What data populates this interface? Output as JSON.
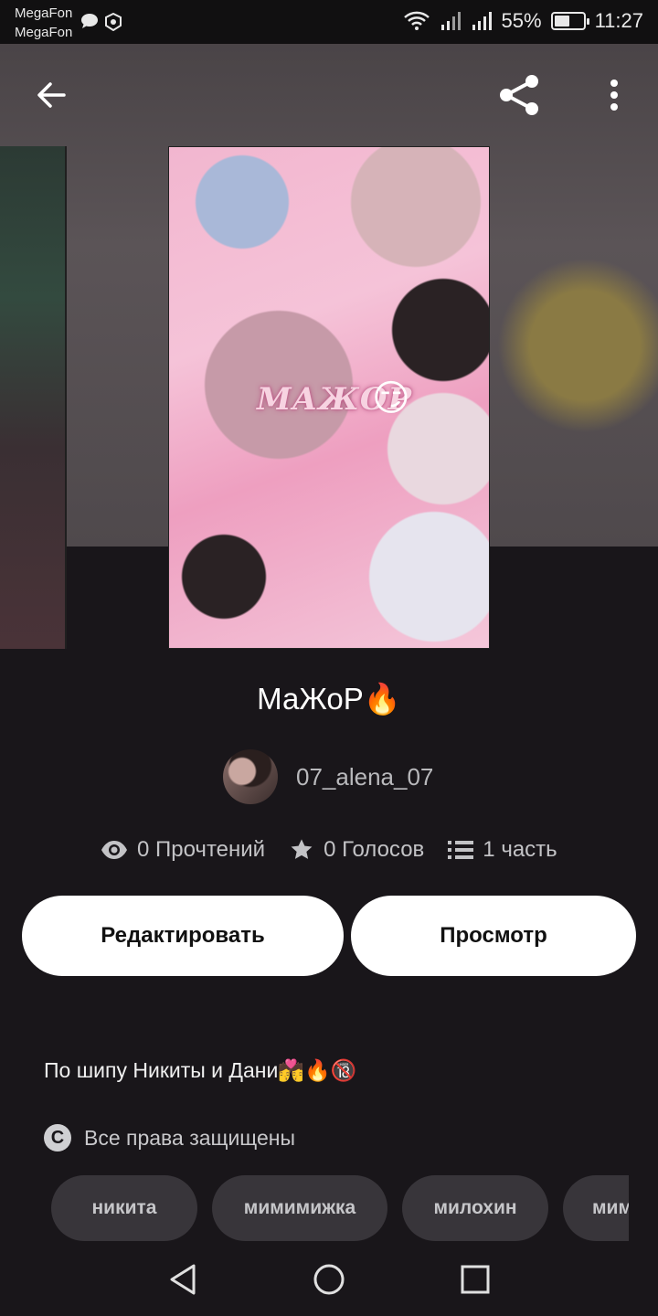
{
  "status_bar": {
    "carrier_line1": "MegaFon",
    "carrier_line2": "MegaFon",
    "battery_percent": "55%",
    "battery_level": 0.55,
    "time": "11:27"
  },
  "story": {
    "title": "МаЖоР🔥",
    "cover_text": "МАЖОР",
    "cover_emoji": "😏",
    "author": "07_alena_07",
    "stats": {
      "reads": "0 Прочтений",
      "votes": "0 Голосов",
      "parts": "1 часть"
    },
    "description": "По шипу Никиты и Дани💏🔥🔞",
    "copyright": "Все права защищены",
    "tags": [
      "никита",
      "мимимижка",
      "милохин",
      "мим"
    ]
  },
  "actions": {
    "edit_label": "Редактировать",
    "view_label": "Просмотр"
  },
  "icons": {
    "back": "arrow-left-icon",
    "share": "share-icon",
    "more": "more-vertical-icon",
    "reads": "eye-icon",
    "votes": "star-icon",
    "parts": "list-icon"
  }
}
